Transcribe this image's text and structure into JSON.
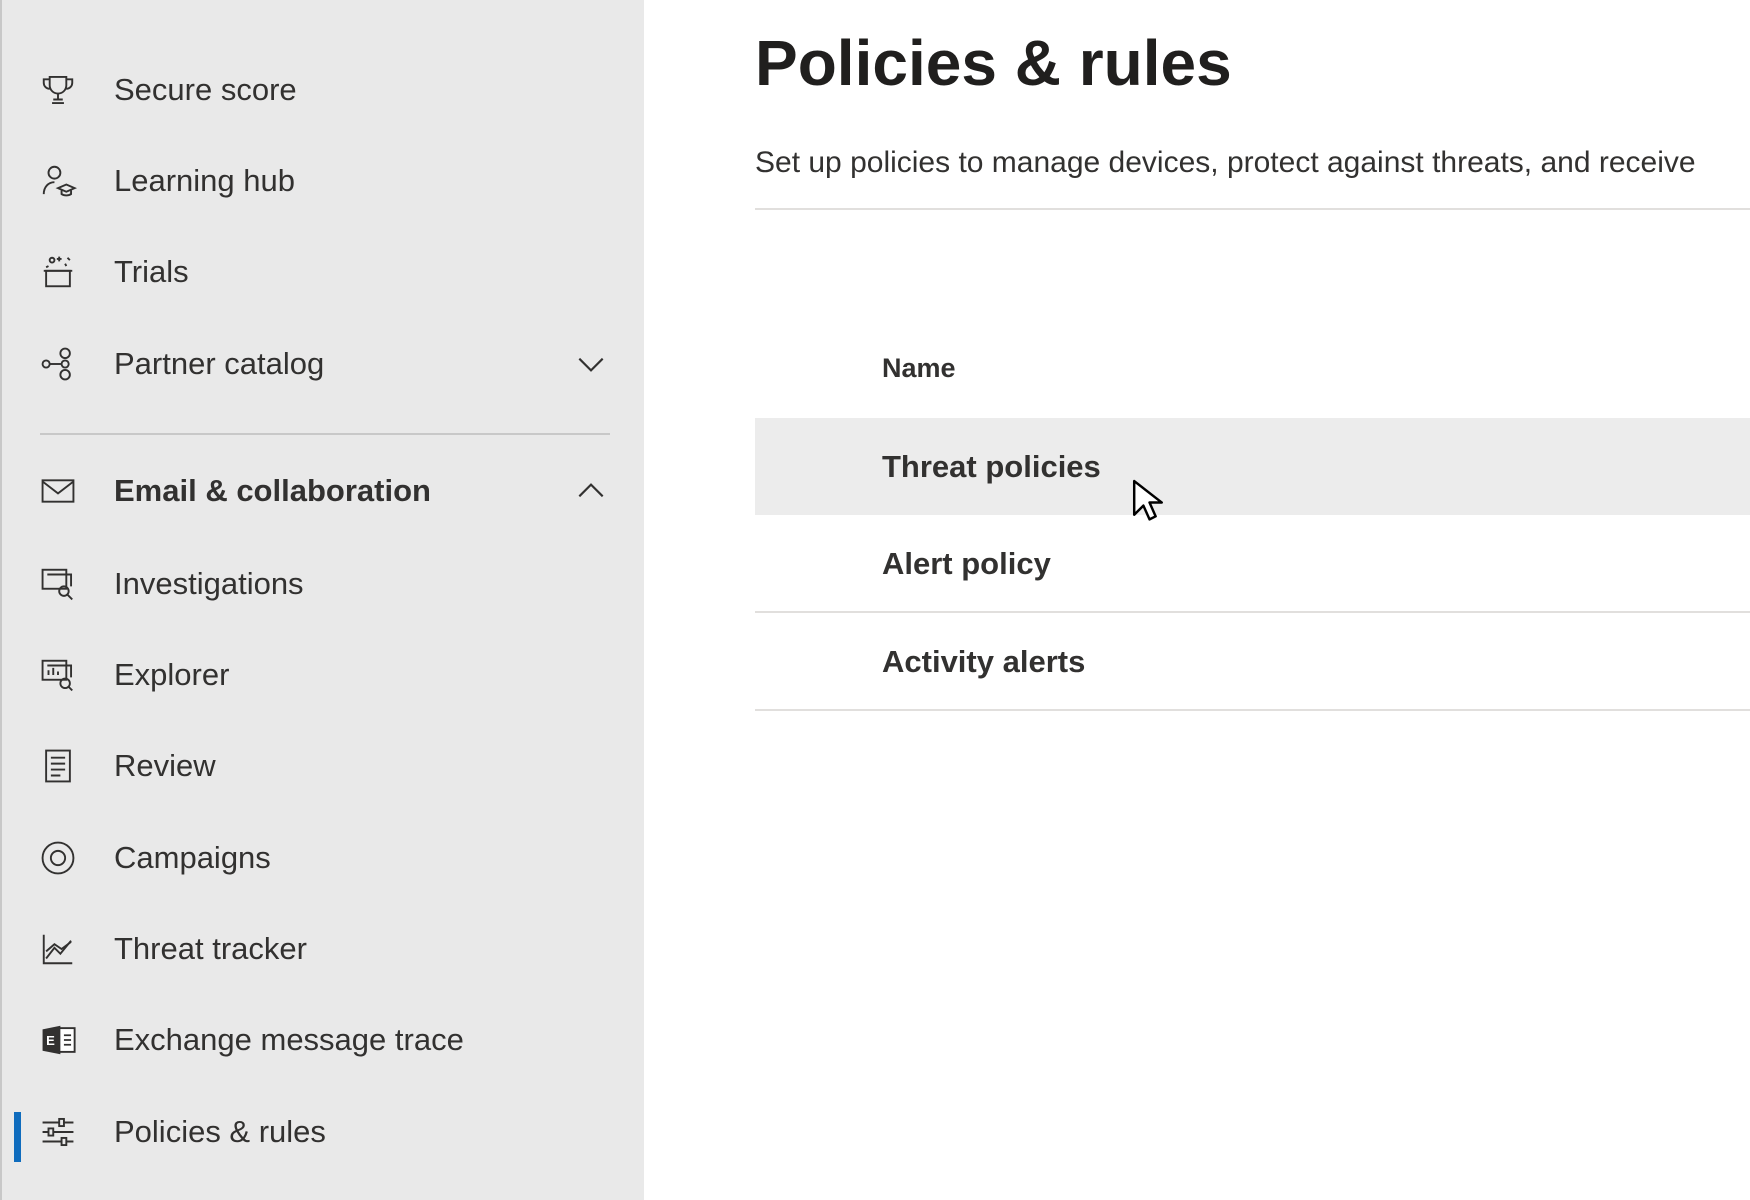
{
  "sidebar": {
    "items": [
      {
        "label": "Secure score",
        "icon": "trophy-icon"
      },
      {
        "label": "Learning hub",
        "icon": "learning-hub-icon"
      },
      {
        "label": "Trials",
        "icon": "trials-icon"
      },
      {
        "label": "Partner catalog",
        "icon": "partner-catalog-icon",
        "expander": "chevron-down-icon"
      },
      {
        "label": "Email & collaboration",
        "icon": "mail-icon",
        "expander": "chevron-up-icon"
      },
      {
        "label": "Investigations",
        "icon": "investigations-icon"
      },
      {
        "label": "Explorer",
        "icon": "explorer-icon"
      },
      {
        "label": "Review",
        "icon": "review-icon"
      },
      {
        "label": "Campaigns",
        "icon": "campaigns-icon"
      },
      {
        "label": "Threat tracker",
        "icon": "threat-tracker-icon"
      },
      {
        "label": "Exchange message trace",
        "icon": "exchange-icon"
      },
      {
        "label": "Policies & rules",
        "icon": "policies-icon",
        "active": true
      }
    ]
  },
  "main": {
    "title": "Policies & rules",
    "description": "Set up policies to manage devices, protect against threats, and receive",
    "table": {
      "column_header": "Name",
      "rows": [
        "Threat policies",
        "Alert policy",
        "Activity alerts"
      ]
    }
  },
  "colors": {
    "sidebar_bg": "#e9e9e9",
    "active_indicator": "#0f6cbd",
    "hover_row": "#ececec"
  }
}
